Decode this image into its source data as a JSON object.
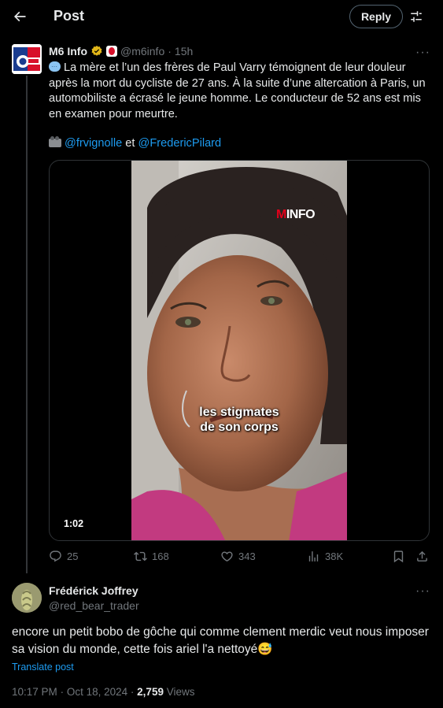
{
  "header": {
    "title": "Post",
    "reply_label": "Reply"
  },
  "tweet": {
    "author_name": "M6 Info",
    "handle": "@m6info",
    "separator": "·",
    "time_ago": "15h",
    "text_line1": "La mère et l’un des frères de Paul Varry témoignent de leur douleur après la mort du cycliste de 27 ans. À la suite d’une altercation à Paris, un automobiliste a écrasé le jeune homme. Le conducteur de 52 ans est mis en examen pour meurtre.",
    "mention_1": "@frvignolle",
    "connector": "et",
    "mention_2": "@FredericPilard",
    "media": {
      "brand_m": "M",
      "brand_info": "INFO",
      "subtitle_line1": "les stigmates",
      "subtitle_line2": "de son corps",
      "duration": "1:02"
    },
    "stats": {
      "replies": "25",
      "reposts": "168",
      "likes": "343",
      "views": "38K"
    }
  },
  "reply": {
    "author_name": "Frédérick Joffrey",
    "handle": "@red_bear_trader",
    "text": "encore un petit bobo de gôche qui comme clement merdic  veut nous imposer sa vision du monde, cette fois ariel l'a nettoyé",
    "emoji": "😅",
    "translate_label": "Translate post",
    "time": "10:17 PM",
    "separator": "·",
    "date": "Oct 18, 2024",
    "views_count": "2,759",
    "views_label": "Views"
  },
  "colors": {
    "background": "#000000",
    "text": "#e7e9ea",
    "muted": "#71767b",
    "link": "#1d9bf0",
    "border": "#2f3336",
    "verified": "#e2b719",
    "brand_red": "#e2001a"
  },
  "icons": {
    "back": "arrow-left-icon",
    "settings": "sliders-icon",
    "verified": "verified-badge-icon",
    "reply": "chat-bubble-icon",
    "repost": "repost-icon",
    "like": "heart-icon",
    "views": "bar-chart-icon",
    "bookmark": "bookmark-icon",
    "share": "share-icon",
    "speech": "speech-bubble-emoji",
    "camera": "video-camera-emoji"
  }
}
